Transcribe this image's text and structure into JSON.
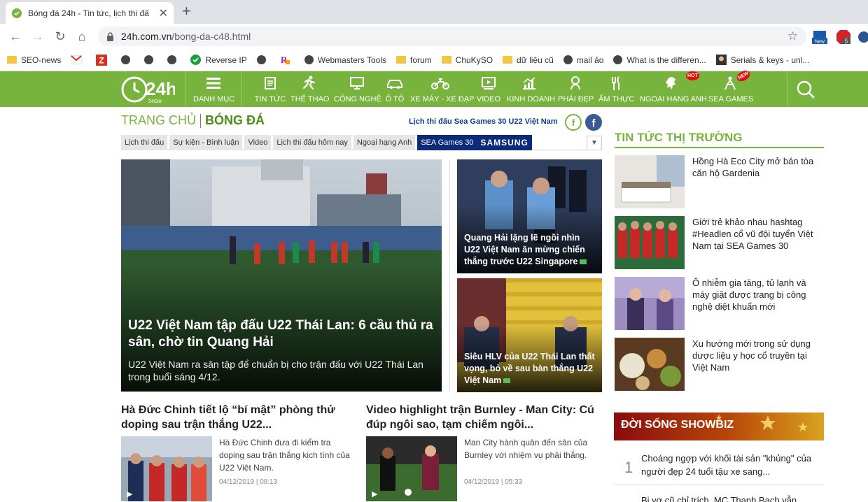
{
  "browser": {
    "tab_title": "Bóng đá 24h - Tin tức, lịch thi đấ",
    "url_host": "24h.com.vn",
    "url_path": "/bong-da-c48.html",
    "ext_new": "New",
    "ext_badge": "5",
    "bookmarks": [
      {
        "icon": "folder-icon",
        "label": "SEO-news"
      },
      {
        "icon": "gmail-icon",
        "label": ""
      },
      {
        "icon": "z-icon",
        "label": ""
      },
      {
        "icon": "globe-icon",
        "label": ""
      },
      {
        "icon": "globe-icon",
        "label": ""
      },
      {
        "icon": "globe-icon",
        "label": ""
      },
      {
        "icon": "check-icon",
        "label": "Reverse IP"
      },
      {
        "icon": "globe-icon",
        "label": ""
      },
      {
        "icon": "r-icon",
        "label": ""
      },
      {
        "icon": "globe-icon",
        "label": "Webmasters Tools"
      },
      {
        "icon": "folder-icon",
        "label": "forum"
      },
      {
        "icon": "folder-icon",
        "label": "ChuKySO"
      },
      {
        "icon": "folder-icon",
        "label": "dữ liệu cũ"
      },
      {
        "icon": "globe-icon",
        "label": "mail ảo"
      },
      {
        "icon": "globe-icon",
        "label": "What is the differen..."
      },
      {
        "icon": "serials-icon",
        "label": "Serials & keys - unl..."
      }
    ]
  },
  "site": {
    "logo_sub": "24Giờ",
    "menu": [
      {
        "label": "DANH MỤC",
        "icon": "hamburger-icon"
      },
      {
        "label": "TIN TỨC",
        "icon": "news-icon"
      },
      {
        "label": "THỂ THAO",
        "icon": "runner-icon"
      },
      {
        "label": "CÔNG NGHỆ",
        "icon": "monitor-icon"
      },
      {
        "label": "Ô TÔ",
        "icon": "car-icon"
      },
      {
        "label": "XE MÁY - XE ĐẠP",
        "icon": "motorbike-icon"
      },
      {
        "label": "VIDEO",
        "icon": "video-icon"
      },
      {
        "label": "KINH DOANH",
        "icon": "chart-icon"
      },
      {
        "label": "PHÁI ĐẸP",
        "icon": "woman-icon"
      },
      {
        "label": "ẨM THỰC",
        "icon": "cutlery-icon"
      },
      {
        "label": "NGOẠI HẠNG ANH",
        "icon": "lion-icon"
      },
      {
        "label": "SEA GAMES",
        "icon": "seagames-icon"
      }
    ],
    "hot": "HOT",
    "new": "NEW"
  },
  "breadcrumb": {
    "home": "TRANG CHỦ",
    "current": "BÓNG ĐÁ"
  },
  "promo_link": "Lịch thi đấu Sea Games 30 U22 Việt Nam",
  "subnav": [
    "Lịch thi đấu",
    "Sự kiện - Bình luận",
    "Video",
    "Lịch thi đấu hôm nay",
    "Ngoại hạng Anh"
  ],
  "subnav_sea": {
    "label": "SEA Games 30",
    "brand": "SAMSUNG"
  },
  "hero": {
    "title": "U22 Việt Nam tập đấu U22 Thái Lan: 6 cầu thủ ra sân, chờ tin Quang Hải",
    "summary": "U22 Việt Nam ra sân tập để chuẩn bị cho trận đấu với U22 Thái Lan trong buổi sáng 4/12."
  },
  "side_stories": [
    {
      "title": "Quang Hải lặng lẽ ngồi nhìn U22 Việt Nam ăn mừng chiến thắng trước U22 Singapore"
    },
    {
      "title": "Siêu HLV của U22 Thái Lan thất vọng, bỏ về sau bàn thắng U22 Việt Nam"
    }
  ],
  "articles": [
    {
      "title": "Hà Đức Chinh tiết lộ “bí mật” phòng thử doping sau trận thắng U22...",
      "summary": "Hà Đức Chinh đưa đi kiểm tra doping sau trận thắng kịch tính của U22 Việt Nam.",
      "time": "04/12/2019 | 08:13"
    },
    {
      "title": "Video highlight trận Burnley - Man City: Cú đúp ngôi sao, tạm chiếm ngôi...",
      "summary": "Man City hành quân đến sân của Burnley với nhiệm vụ phải thắng.",
      "time": "04/12/2019 | 05:33"
    }
  ],
  "market": {
    "title": "TIN TỨC THỊ TRƯỜNG",
    "items": [
      "Hồng Hà Eco City mở bán tòa căn hộ Gardenia",
      "Giới trẻ khảo nhau hashtag #Headlen cổ vũ đội tuyển Việt Nam tại SEA Games 30",
      "Ô nhiễm gia tăng, tủ lạnh và máy giặt được trang bị công nghệ diệt khuẩn mới",
      "Xu hướng mới trong sử dụng dược liệu y học cổ truyền tại Việt Nam"
    ]
  },
  "showbiz": {
    "title": "ĐỜI SỐNG SHOWBIZ",
    "items": [
      {
        "num": "1",
        "title": "Choáng ngợp với khối tài sản \"khủng\" của người đẹp 24 tuổi tậu xe sang..."
      },
      {
        "num": "",
        "title": "Bị vợ cũ chỉ trích, MC Thanh Bạch vẫn"
      }
    ]
  },
  "colors": {
    "brand_green": "#78b43d",
    "sea_blue": "#0a2b7a"
  }
}
